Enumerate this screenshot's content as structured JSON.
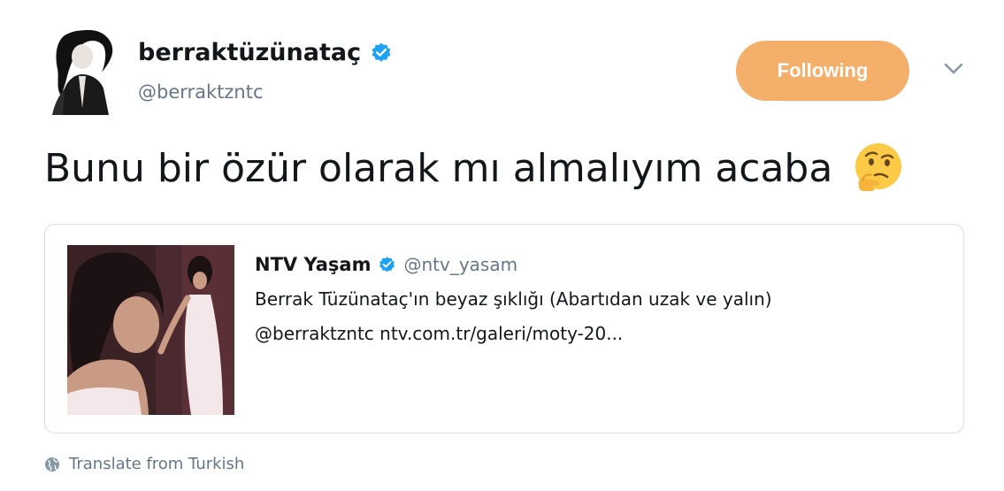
{
  "author": {
    "display_name": "berraktüzünataç",
    "handle": "@berraktzntc",
    "verified": true,
    "avatar_icon": "profile-photo"
  },
  "actions": {
    "follow_label": "Following",
    "more_icon": "chevron-down-icon"
  },
  "tweet": {
    "text": "Bunu bir özür olarak mı almalıyım acaba",
    "emoji": "thinking-face"
  },
  "quoted_tweet": {
    "display_name": "NTV Yaşam",
    "handle": "@ntv_yasam",
    "verified": true,
    "line1": "Berrak Tüzünataç'ın beyaz şıklığı (Abartıdan uzak ve yalın)",
    "line2": "@berraktzntc ntv.com.tr/galeri/moty-20..."
  },
  "footer": {
    "translate_label": "Translate from Turkish",
    "translate_icon": "globe-icon"
  },
  "colors": {
    "follow_button": "#f4b06a",
    "verified_badge": "#1da1f2",
    "secondary_text": "#657786",
    "border": "#d8dee3"
  }
}
